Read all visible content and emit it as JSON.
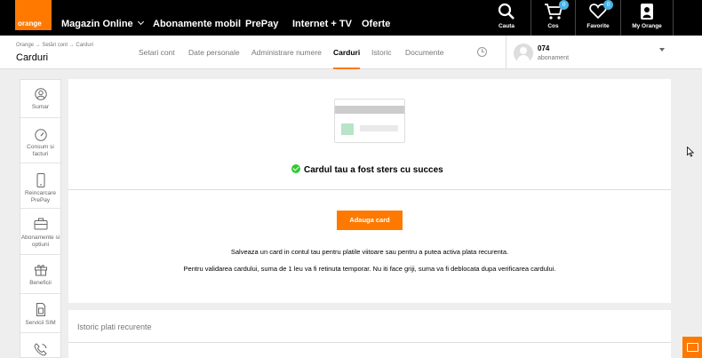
{
  "brand": {
    "logo_text": "orange",
    "accent": "#ff7900"
  },
  "topnav": {
    "items": [
      {
        "label": "Magazin Online",
        "has_dropdown": true
      },
      {
        "label": "Abonamente mobil"
      },
      {
        "label": "PrePay"
      },
      {
        "label": "Internet + TV"
      },
      {
        "label": "Oferte"
      }
    ],
    "tools": [
      {
        "label": "Cauta",
        "icon": "search-icon"
      },
      {
        "label": "Cos",
        "icon": "cart-icon",
        "badge": "0"
      },
      {
        "label": "Favorite",
        "icon": "heart-icon",
        "badge": "0"
      },
      {
        "label": "My Orange",
        "icon": "user-phone-icon"
      }
    ]
  },
  "subheader": {
    "breadcrumb": "Orange → Setări cont → Carduri",
    "title": "Carduri",
    "tabs": [
      {
        "label": "Setari cont"
      },
      {
        "label": "Date personale"
      },
      {
        "label": "Administrare numere"
      },
      {
        "label": "Carduri",
        "active": true
      },
      {
        "label": "Istoric"
      },
      {
        "label": "Documente"
      }
    ],
    "history_icon": "clock-icon",
    "account": {
      "number": "074",
      "subtitle": "abonament"
    }
  },
  "sidebar": {
    "items": [
      {
        "label": "Sumar",
        "icon": "user-circle-icon"
      },
      {
        "label": "Consum si facturi",
        "icon": "gauge-icon"
      },
      {
        "label": "Reincarcare PrePay",
        "icon": "phone-icon"
      },
      {
        "label": "Abonamente si optiuni",
        "icon": "briefcase-icon"
      },
      {
        "label": "Beneficii",
        "icon": "gift-icon"
      },
      {
        "label": "Servicii SIM",
        "icon": "sim-card-icon"
      },
      {
        "label": "",
        "icon": "phone-call-icon"
      }
    ]
  },
  "main": {
    "success_message": "Cardul tau a fost sters cu succes",
    "add_button": "Adauga card",
    "info_line_1": "Salveaza un card in contul tau pentru platile viitoare sau pentru a putea activa plata recurenta.",
    "info_line_2": "Pentru validarea cardului, suma de 1 leu va fi retinuta temporar. Nu iti face griji, suma va fi deblocata dupa verificarea cardului."
  },
  "history": {
    "title": "Istoric plati recurente"
  }
}
